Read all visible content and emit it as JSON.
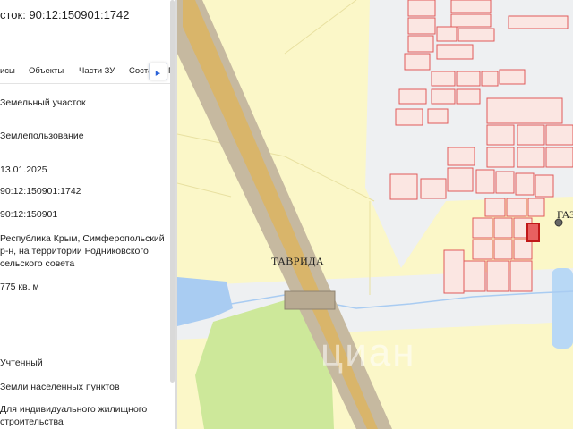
{
  "panel": {
    "title": "сток: 90:12:150901:1742",
    "tabs": [
      "исы",
      "Объекты",
      "Части ЗУ",
      "Соста",
      "Г"
    ],
    "values": [
      "Земельный участок",
      "Землепользование",
      "13.01.2025",
      "90:12:150901:1742",
      "90:12:150901",
      "Республика Крым, Симферопольский",
      "р-н, на территории Родниковского",
      "сельского совета",
      "775 кв. м",
      "Учтенный",
      "Земли населенных пунктов",
      "Для индивидуального жилищного",
      "строительства"
    ]
  },
  "map": {
    "road_label": "ТАВРИДА",
    "gas_label": "ГАЗ",
    "watermark": "циан",
    "colors": {
      "land": "#fbf7c8",
      "road": "#c6b9a0",
      "road_center": "#d9b56a",
      "water": "#b8d8f5",
      "green": "#cde89a",
      "parcel_line": "#e05a5a",
      "parcel_fill": "#fbe6e2",
      "selected_parcel": "#d83a3a"
    }
  }
}
